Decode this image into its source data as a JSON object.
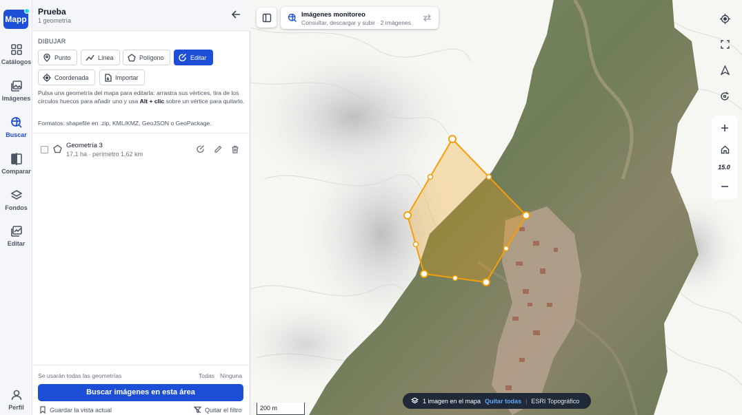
{
  "app": {
    "logo_text": "Mapp",
    "brand_color": "#1d4ed8"
  },
  "rail": {
    "items": [
      {
        "label": "Catálogos",
        "icon": "grid-icon"
      },
      {
        "label": "Imágenes",
        "icon": "images-icon"
      },
      {
        "label": "Buscar",
        "icon": "search-globe-icon",
        "active": true
      },
      {
        "label": "Comparar",
        "icon": "compare-icon"
      },
      {
        "label": "Fondos",
        "icon": "layers-icon"
      },
      {
        "label": "Editar",
        "icon": "edit-images-icon"
      }
    ],
    "profile_label": "Perfil"
  },
  "panel": {
    "title": "Prueba",
    "subtitle": "1 geometría",
    "section_label": "DIBUJAR",
    "draw_buttons": {
      "punto": "Punto",
      "linea": "Línea",
      "poligono": "Polígono",
      "editar": "Editar",
      "coordenada": "Coordenada",
      "importar": "Importar"
    },
    "help_part1": "Pulsa una geometría del mapa para editarla: arrastra sus vértices, tira de los círculos huecos para añadir uno y usa ",
    "help_bold": "Alt + clic",
    "help_part2": " sobre un vértice para quitarlo.",
    "formats": "Formatos: shapefile en .zip, KML/KMZ, GeoJSON o GeoPackage.",
    "geometry": {
      "name": "Geometría 3",
      "meta": "17,1 ha · perímetro 1,62 km"
    },
    "footer_note": "Se usarán todas las geometrías",
    "all_link": "Todas",
    "none_link": "Ninguna",
    "search_button": "Buscar imágenes en esta área",
    "save_view": "Guardar la vista actual",
    "clear_filter": "Quitar el filtro"
  },
  "map": {
    "image_card_title": "Imágenes monitoreo",
    "image_card_sub": "Consultar, descargar y subir · 2 imágenes",
    "zoom_level": "15.0",
    "scale_label": "200 m",
    "pill_count": "1 imagen en el mapa",
    "pill_remove": "Quitar todas",
    "pill_basemap": "ESRI Topográfico",
    "polygon_color": "#f59e0b"
  }
}
